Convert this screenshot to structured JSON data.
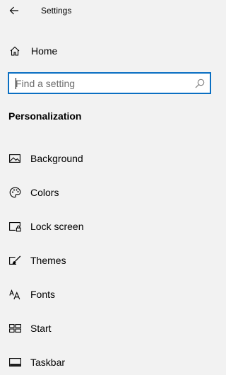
{
  "header": {
    "title": "Settings",
    "back_icon": "back-arrow-icon"
  },
  "home": {
    "label": "Home",
    "icon": "home-icon"
  },
  "search": {
    "placeholder": "Find a setting",
    "value": "",
    "icon": "search-icon",
    "accent_color": "#0a6fc2"
  },
  "section": {
    "title": "Personalization"
  },
  "nav_items": [
    {
      "label": "Background",
      "icon": "picture-icon"
    },
    {
      "label": "Colors",
      "icon": "palette-icon"
    },
    {
      "label": "Lock screen",
      "icon": "lock-screen-icon"
    },
    {
      "label": "Themes",
      "icon": "brush-icon"
    },
    {
      "label": "Fonts",
      "icon": "font-icon"
    },
    {
      "label": "Start",
      "icon": "start-layout-icon"
    },
    {
      "label": "Taskbar",
      "icon": "taskbar-icon"
    }
  ],
  "colors": {
    "background": "#f2f2f2",
    "text": "#000000"
  }
}
